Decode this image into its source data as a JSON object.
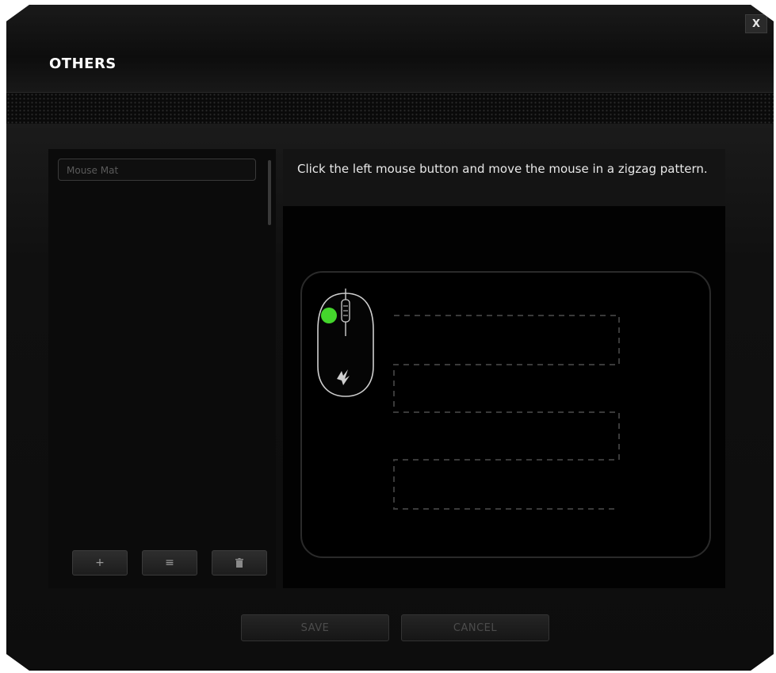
{
  "window": {
    "title": "OTHERS",
    "close_label": "X"
  },
  "sidebar": {
    "items": [
      {
        "label": "Mouse Mat"
      }
    ],
    "buttons": {
      "add_label": "+",
      "edit_label": "≡",
      "delete_label": "🗑"
    }
  },
  "main": {
    "instruction": "Click the left mouse button and move the mouse in a zigzag pattern."
  },
  "footer": {
    "save_label": "SAVE",
    "cancel_label": "CANCEL"
  },
  "colors": {
    "accent": "#44d62c",
    "background": "#121212"
  },
  "icons": {
    "mouse": "mouse-icon",
    "logo": "razer-logo-icon",
    "delete": "trash-icon"
  }
}
